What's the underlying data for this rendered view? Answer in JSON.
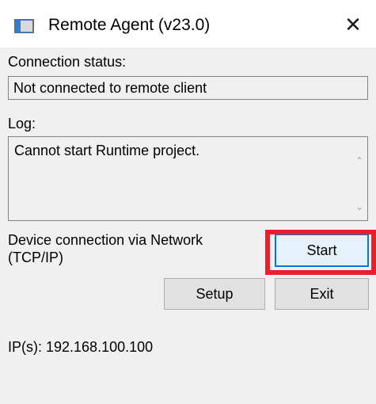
{
  "window": {
    "title": "Remote Agent (v23.0)",
    "icon": "app-window-icon",
    "close_glyph": "✕"
  },
  "connection": {
    "label": "Connection status:",
    "value": "Not connected to remote client"
  },
  "log": {
    "label": "Log:",
    "text": "Cannot start Runtime project.",
    "scroll_up_glyph": "⌃",
    "scroll_down_glyph": "⌄"
  },
  "device": {
    "line1": "Device connection via Network",
    "line2": "(TCP/IP)"
  },
  "buttons": {
    "start": "Start",
    "setup": "Setup",
    "exit": "Exit"
  },
  "ip": {
    "text": "IP(s): 192.168.100.100"
  },
  "colors": {
    "highlight": "#e8202e",
    "default_button_border": "#0078d7",
    "dialog_background": "#f0f0f0"
  }
}
